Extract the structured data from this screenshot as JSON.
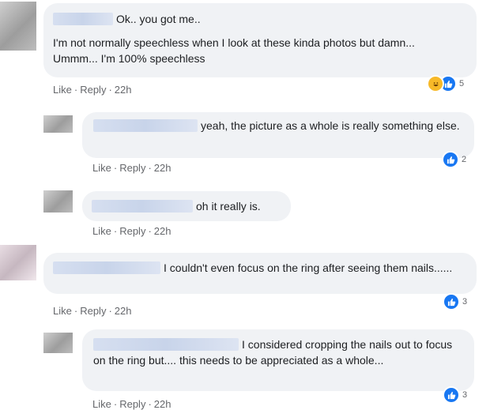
{
  "actions": {
    "like": "Like",
    "reply": "Reply",
    "sep": "·"
  },
  "comments": [
    {
      "text": "Ok.. you got me..\nI'm not normally speechless when I look at these kinda photos but damn... Ummm... I'm 100% speechless",
      "time": "22h",
      "reaction_count": "5",
      "reactions": [
        "haha-icon",
        "like-icon"
      ]
    },
    {
      "text": "yeah, the picture as a whole is really something else.",
      "time": "22h",
      "reaction_count": "2",
      "reactions": [
        "like-icon"
      ]
    },
    {
      "text": "oh it really is.",
      "time": "22h"
    },
    {
      "text": "I couldn't even focus on the ring after seeing them nails......",
      "time": "22h",
      "reaction_count": "3",
      "reactions": [
        "like-icon"
      ]
    },
    {
      "text": "I considered cropping the nails out to focus on the ring but.... this needs to be appreciated as a whole...",
      "time": "22h",
      "reaction_count": "3",
      "reactions": [
        "like-icon"
      ]
    }
  ],
  "colors": {
    "bubble": "#f0f2f5",
    "link": "#65676b",
    "like_blue": "#1877f2",
    "haha_yellow": "#f7b928"
  }
}
